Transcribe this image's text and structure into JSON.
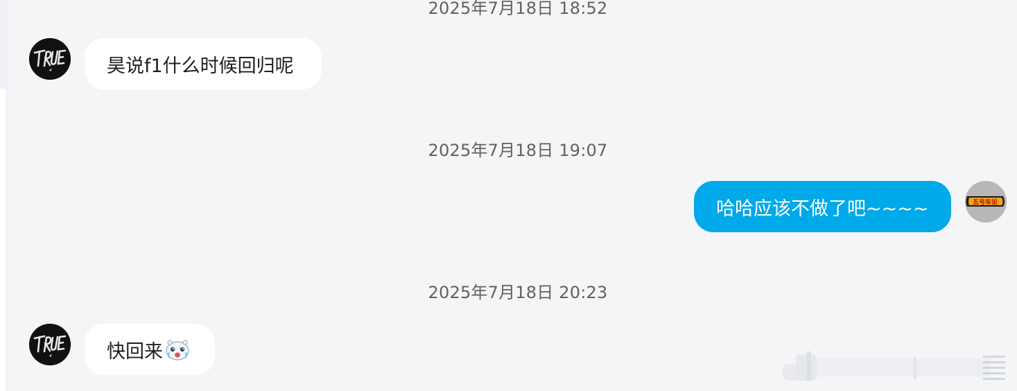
{
  "timestamps": {
    "t1": "2025年7月18日 18:52",
    "t2": "2025年7月18日 19:07",
    "t3": "2025年7月18日 20:23"
  },
  "messages": [
    {
      "sender": "other",
      "text": "昊说f1什么时候回归呢"
    },
    {
      "sender": "self",
      "text": "哈哈应该不做了吧~~~~"
    },
    {
      "sender": "other",
      "text": "快回来",
      "emoji": "crying-face-emoji"
    }
  ],
  "avatars": {
    "other": {
      "logo_text": "TRUE",
      "icon": "true-logo-avatar"
    },
    "self": {
      "logo_text": "五号车论",
      "icon": "wuhao-chelun-logo-avatar"
    }
  },
  "colors": {
    "background": "#f4f5f7",
    "incoming_bubble": "#ffffff",
    "outgoing_bubble": "#00a9ea",
    "timestamp_text": "#616161"
  }
}
